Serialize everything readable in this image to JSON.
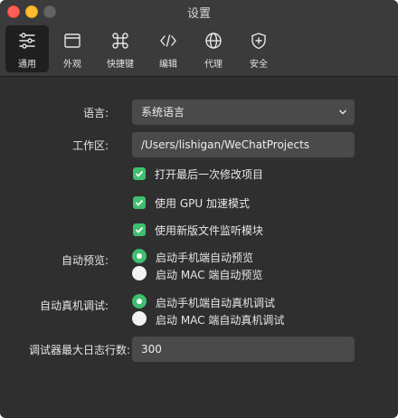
{
  "window": {
    "title": "设置"
  },
  "tabs": [
    {
      "label": "通用",
      "icon": "general-sliders-icon",
      "active": true
    },
    {
      "label": "外观",
      "icon": "appearance-window-icon"
    },
    {
      "label": "快捷键",
      "icon": "shortcut-command-icon"
    },
    {
      "label": "编辑",
      "icon": "code-editor-icon"
    },
    {
      "label": "代理",
      "icon": "proxy-globe-icon"
    },
    {
      "label": "安全",
      "icon": "security-shield-icon"
    }
  ],
  "language": {
    "label": "语言:",
    "value": "系统语言"
  },
  "workspace": {
    "label": "工作区:",
    "value": "/Users/lishigan/WeChatProjects"
  },
  "checkboxes": [
    {
      "label": "打开最后一次修改项目",
      "checked": true
    },
    {
      "label": "使用 GPU 加速模式",
      "checked": true
    },
    {
      "label": "使用新版文件监听模块",
      "checked": true
    }
  ],
  "auto_preview": {
    "label": "自动预览:",
    "options": [
      {
        "label": "启动手机端自动预览",
        "selected": true
      },
      {
        "label": "启动 MAC 端自动预览",
        "selected": false
      }
    ]
  },
  "auto_debug": {
    "label": "自动真机调试:",
    "options": [
      {
        "label": "启动手机端自动真机调试",
        "selected": true
      },
      {
        "label": "启动 MAC 端自动真机调试",
        "selected": false
      }
    ]
  },
  "max_log": {
    "label": "调试器最大日志行数:",
    "value": "300"
  },
  "colors": {
    "accent": "#3fbf6f",
    "background": "#2f2f2f",
    "field": "#4a4a4a"
  }
}
